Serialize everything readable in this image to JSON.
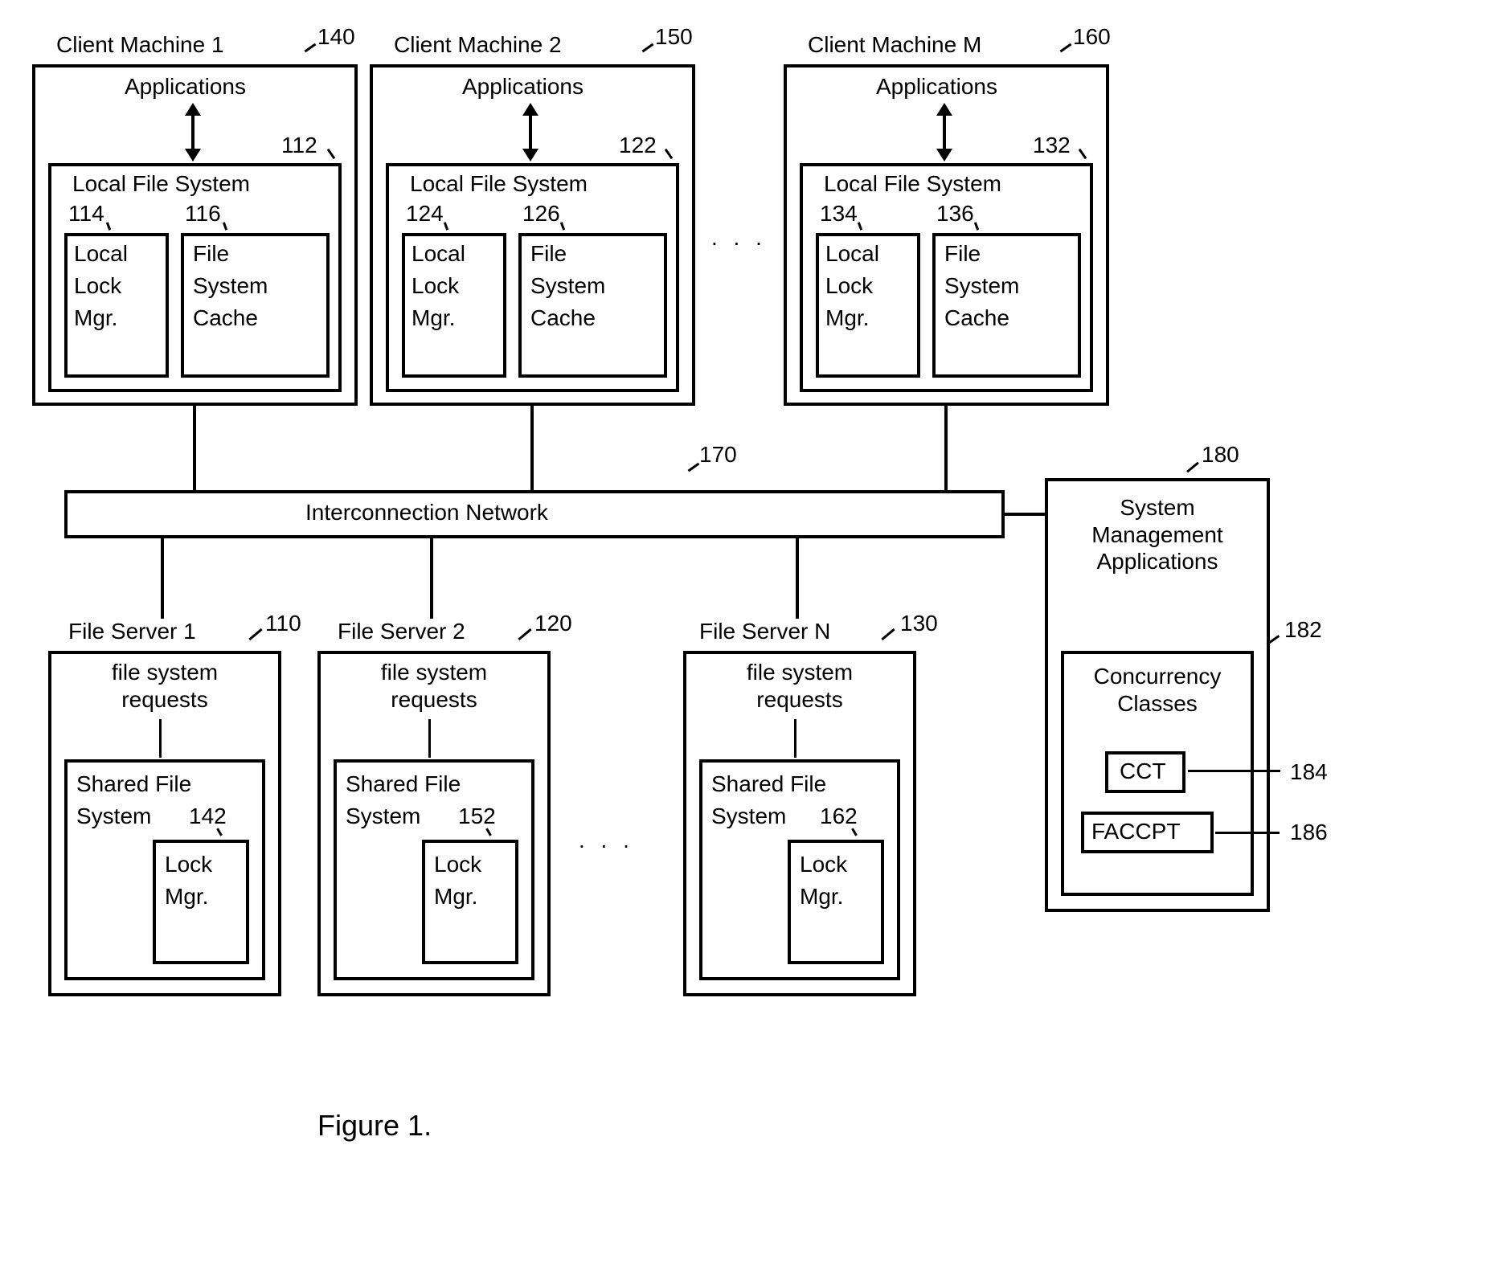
{
  "figure_caption": "Figure 1.",
  "network_box_label": "Interconnection Network",
  "ref_network": "170",
  "ellipsis": ". . .",
  "clients": [
    {
      "title": "Client Machine 1",
      "ref": "140",
      "apps_label": "Applications",
      "lfs_label": "Local File System",
      "lfs_ref": "112",
      "llm_label_l1": "Local",
      "llm_label_l2": "Lock",
      "llm_label_l3": "Mgr.",
      "llm_ref": "114",
      "fsc_label_l1": "File",
      "fsc_label_l2": "System",
      "fsc_label_l3": "Cache",
      "fsc_ref": "116"
    },
    {
      "title": "Client Machine 2",
      "ref": "150",
      "apps_label": "Applications",
      "lfs_label": "Local File System",
      "lfs_ref": "122",
      "llm_label_l1": "Local",
      "llm_label_l2": "Lock",
      "llm_label_l3": "Mgr.",
      "llm_ref": "124",
      "fsc_label_l1": "File",
      "fsc_label_l2": "System",
      "fsc_label_l3": "Cache",
      "fsc_ref": "126"
    },
    {
      "title": "Client Machine M",
      "ref": "160",
      "apps_label": "Applications",
      "lfs_label": "Local File System",
      "lfs_ref": "132",
      "llm_label_l1": "Local",
      "llm_label_l2": "Lock",
      "llm_label_l3": "Mgr.",
      "llm_ref": "134",
      "fsc_label_l1": "File",
      "fsc_label_l2": "System",
      "fsc_label_l3": "Cache",
      "fsc_ref": "136"
    }
  ],
  "servers": [
    {
      "title": "File Server 1",
      "ref": "110",
      "fsr_l1": "file system",
      "fsr_l2": "requests",
      "sfs_l1": "Shared File",
      "sfs_l2": "System",
      "lock_ref": "142",
      "lock_l1": "Lock",
      "lock_l2": "Mgr."
    },
    {
      "title": "File Server 2",
      "ref": "120",
      "fsr_l1": "file system",
      "fsr_l2": "requests",
      "sfs_l1": "Shared File",
      "sfs_l2": "System",
      "lock_ref": "152",
      "lock_l1": "Lock",
      "lock_l2": "Mgr."
    },
    {
      "title": "File Server N",
      "ref": "130",
      "fsr_l1": "file system",
      "fsr_l2": "requests",
      "sfs_l1": "Shared File",
      "sfs_l2": "System",
      "lock_ref": "162",
      "lock_l1": "Lock",
      "lock_l2": "Mgr."
    }
  ],
  "sysmgmt": {
    "ref": "180",
    "title_l1": "System",
    "title_l2": "Management",
    "title_l3": "Applications",
    "cc_ref": "182",
    "cc_l1": "Concurrency",
    "cc_l2": "Classes",
    "cct_label": "CCT",
    "cct_ref": "184",
    "faccpt_label": "FACCPT",
    "faccpt_ref": "186"
  }
}
